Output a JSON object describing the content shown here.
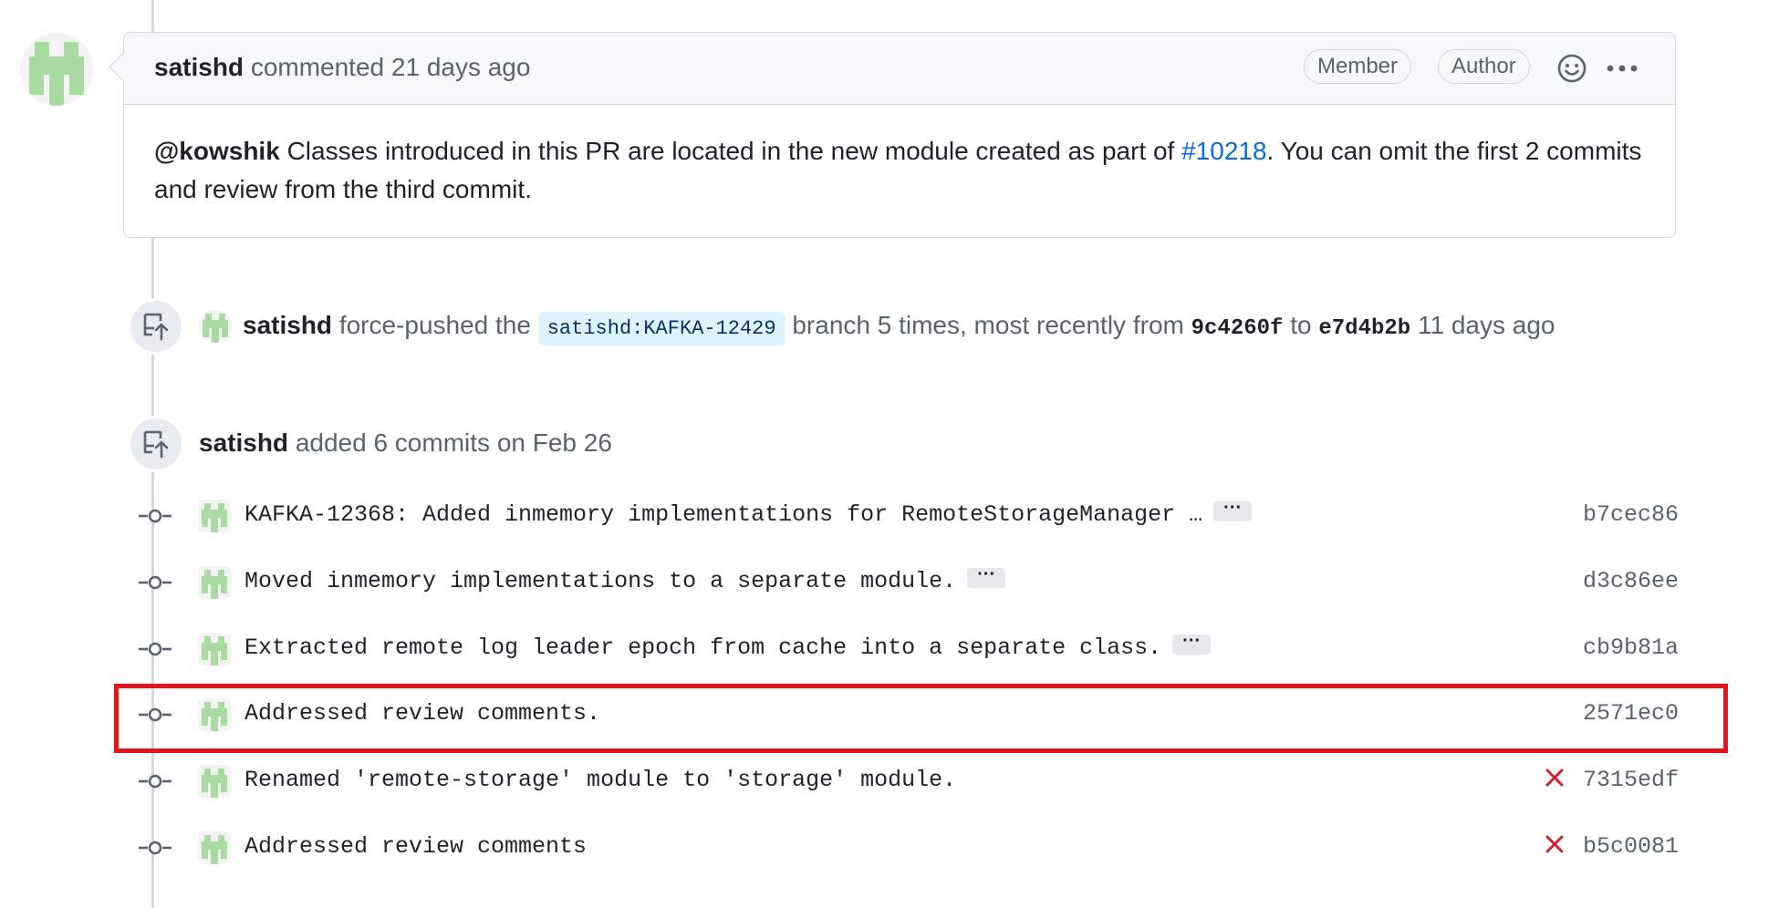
{
  "comment": {
    "author": "satishd",
    "action": "commented",
    "time": "21 days ago",
    "badges": [
      "Member",
      "Author"
    ],
    "mention": "@kowshik",
    "body_part1": " Classes introduced in this PR are located in the new module created as part of ",
    "link_text": "#10218",
    "body_part2": ". You can omit the first 2 commits and review from the third commit."
  },
  "force_push": {
    "author": "satishd",
    "action_prefix": "force-pushed the",
    "branch": "satishd:KAFKA-12429",
    "action_mid": "branch 5 times, most recently from",
    "from_sha": "9c4260f",
    "to_word": "to",
    "to_sha": "e7d4b2b",
    "time": "11 days ago"
  },
  "commits_event": {
    "author": "satishd",
    "action": "added 6 commits",
    "date": "on Feb 26"
  },
  "commits": [
    {
      "message": "KAFKA-12368: Added inmemory implementations for RemoteStorageManager …",
      "ellipsis": "···",
      "sha": "b7cec86",
      "status": ""
    },
    {
      "message": "Moved inmemory implementations to a separate module.",
      "ellipsis": "···",
      "sha": "d3c86ee",
      "status": ""
    },
    {
      "message": "Extracted remote log leader epoch from cache into a separate class.",
      "ellipsis": "···",
      "sha": "cb9b81a",
      "status": ""
    },
    {
      "message": "Addressed review comments.",
      "ellipsis": "",
      "sha": "2571ec0",
      "status": ""
    },
    {
      "message": "Renamed 'remote-storage' module to 'storage' module.",
      "ellipsis": "",
      "sha": "7315edf",
      "status": "failed"
    },
    {
      "message": "Addressed review comments",
      "ellipsis": "",
      "sha": "b5c0081",
      "status": "failed"
    }
  ],
  "icons": {
    "avatar": "identicon-avatar",
    "push": "repo-push-icon",
    "commit": "git-commit-icon",
    "smiley": "smiley-icon",
    "kebab": "kebab-horizontal-icon",
    "fail": "x-icon"
  },
  "colors": {
    "link": "#0969da",
    "fail": "#cf222e",
    "highlight": "#e3161f",
    "identicon": "#a8dba0"
  }
}
